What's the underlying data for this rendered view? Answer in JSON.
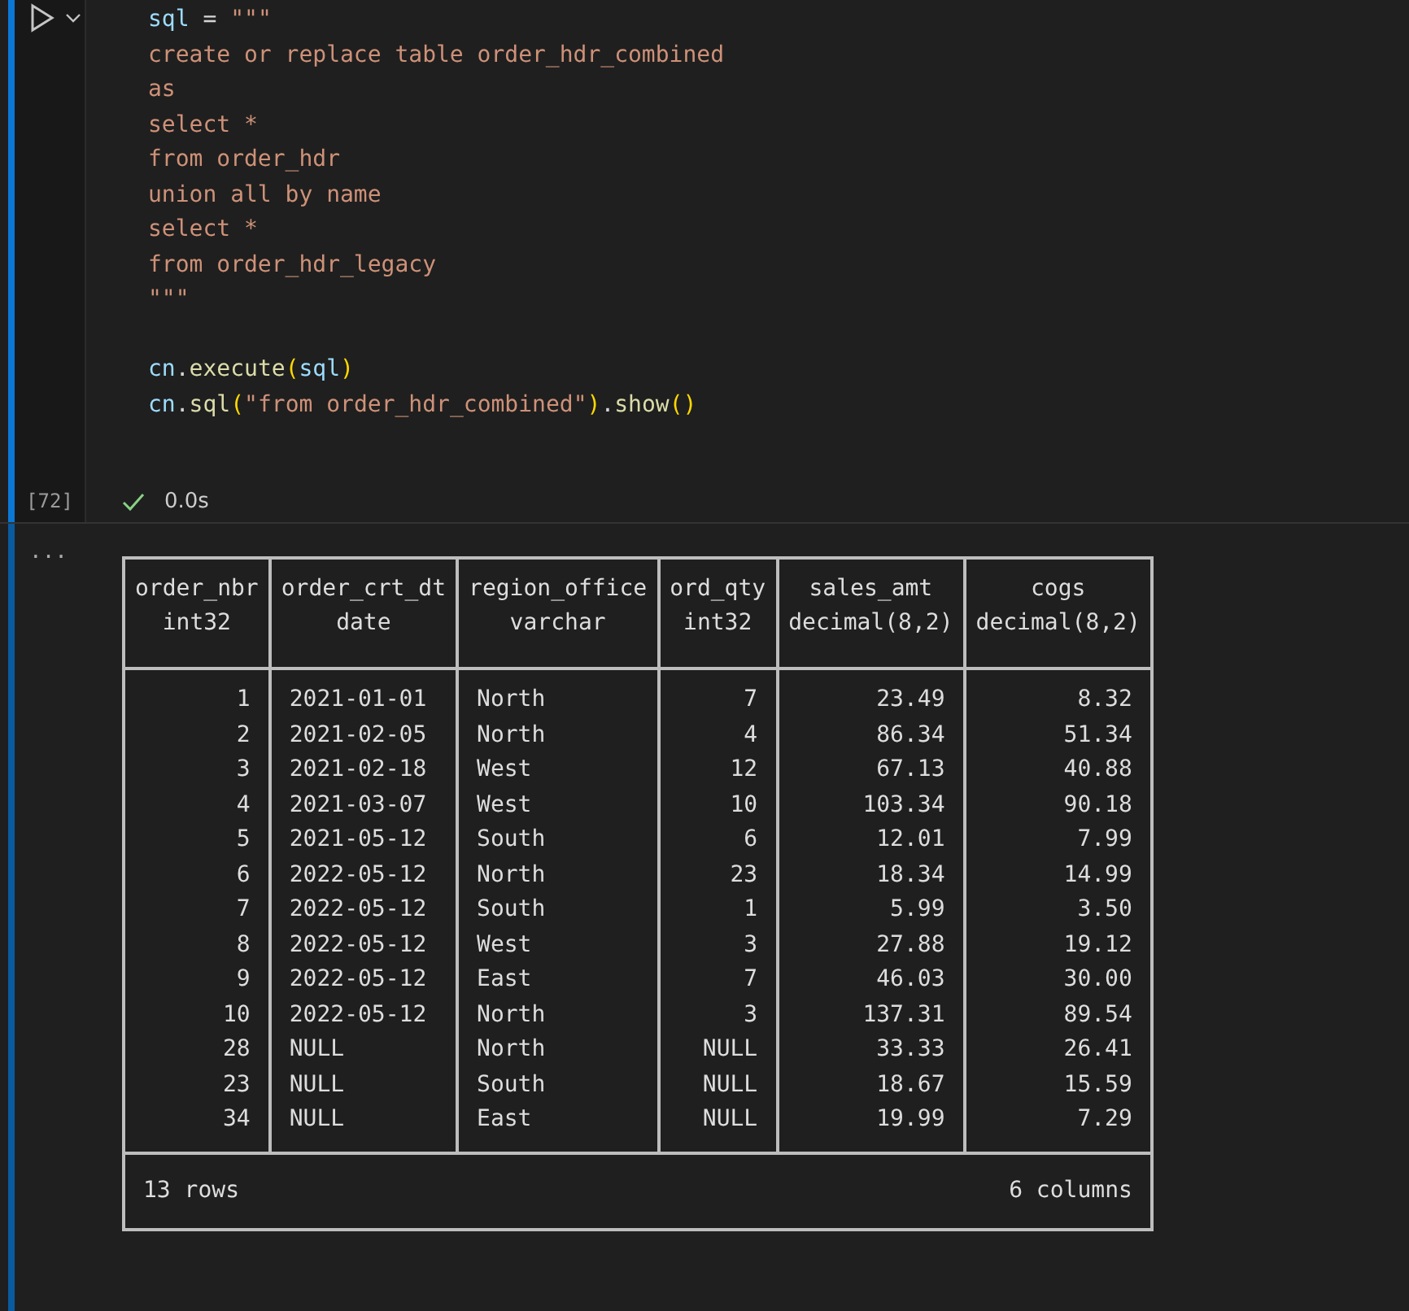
{
  "cell": {
    "execution_count": "[72]",
    "succeeded": true,
    "duration": "0.0s",
    "code": [
      [
        {
          "kind": "var",
          "text": "sql"
        },
        {
          "kind": "op",
          "text": " = "
        },
        {
          "kind": "str",
          "text": "\"\"\""
        }
      ],
      [
        {
          "kind": "str",
          "text": "create or replace table order_hdr_combined"
        }
      ],
      [
        {
          "kind": "str",
          "text": "as"
        }
      ],
      [
        {
          "kind": "str",
          "text": "select *"
        }
      ],
      [
        {
          "kind": "str",
          "text": "from order_hdr"
        }
      ],
      [
        {
          "kind": "str",
          "text": "union all by name"
        }
      ],
      [
        {
          "kind": "str",
          "text": "select *"
        }
      ],
      [
        {
          "kind": "str",
          "text": "from order_hdr_legacy"
        }
      ],
      [
        {
          "kind": "str",
          "text": "\"\"\""
        }
      ],
      [
        {
          "kind": "blank"
        }
      ],
      [
        {
          "kind": "var",
          "text": "cn"
        },
        {
          "kind": "op",
          "text": "."
        },
        {
          "kind": "fn",
          "text": "execute"
        },
        {
          "kind": "paren",
          "text": "("
        },
        {
          "kind": "var",
          "text": "sql"
        },
        {
          "kind": "paren",
          "text": ")"
        }
      ],
      [
        {
          "kind": "var",
          "text": "cn"
        },
        {
          "kind": "op",
          "text": "."
        },
        {
          "kind": "fn",
          "text": "sql"
        },
        {
          "kind": "paren",
          "text": "("
        },
        {
          "kind": "str",
          "text": "\"from order_hdr_combined\""
        },
        {
          "kind": "paren",
          "text": ")"
        },
        {
          "kind": "op",
          "text": "."
        },
        {
          "kind": "fn",
          "text": "show"
        },
        {
          "kind": "paren",
          "text": "()"
        }
      ]
    ]
  },
  "output": {
    "more": "...",
    "table": {
      "columns": [
        {
          "name": "order_nbr",
          "type": "int32",
          "kind": "numeric"
        },
        {
          "name": "order_crt_dt",
          "type": "date",
          "kind": "text"
        },
        {
          "name": "region_office",
          "type": "varchar",
          "kind": "text"
        },
        {
          "name": "ord_qty",
          "type": "int32",
          "kind": "numeric"
        },
        {
          "name": "sales_amt",
          "type": "decimal(8,2)",
          "kind": "numeric"
        },
        {
          "name": "cogs",
          "type": "decimal(8,2)",
          "kind": "numeric"
        }
      ],
      "rows": [
        [
          "1",
          "2021-01-01",
          "North",
          "7",
          "23.49",
          "8.32"
        ],
        [
          "2",
          "2021-02-05",
          "North",
          "4",
          "86.34",
          "51.34"
        ],
        [
          "3",
          "2021-02-18",
          "West",
          "12",
          "67.13",
          "40.88"
        ],
        [
          "4",
          "2021-03-07",
          "West",
          "10",
          "103.34",
          "90.18"
        ],
        [
          "5",
          "2021-05-12",
          "South",
          "6",
          "12.01",
          "7.99"
        ],
        [
          "6",
          "2022-05-12",
          "North",
          "23",
          "18.34",
          "14.99"
        ],
        [
          "7",
          "2022-05-12",
          "South",
          "1",
          "5.99",
          "3.50"
        ],
        [
          "8",
          "2022-05-12",
          "West",
          "3",
          "27.88",
          "19.12"
        ],
        [
          "9",
          "2022-05-12",
          "East",
          "7",
          "46.03",
          "30.00"
        ],
        [
          "10",
          "2022-05-12",
          "North",
          "3",
          "137.31",
          "89.54"
        ],
        [
          "28",
          "NULL",
          "North",
          "NULL",
          "33.33",
          "26.41"
        ],
        [
          "23",
          "NULL",
          "South",
          "NULL",
          "18.67",
          "15.59"
        ],
        [
          "34",
          "NULL",
          "East",
          "NULL",
          "19.99",
          "7.29"
        ]
      ],
      "row_count": "13 rows",
      "column_count": "6 columns"
    }
  }
}
